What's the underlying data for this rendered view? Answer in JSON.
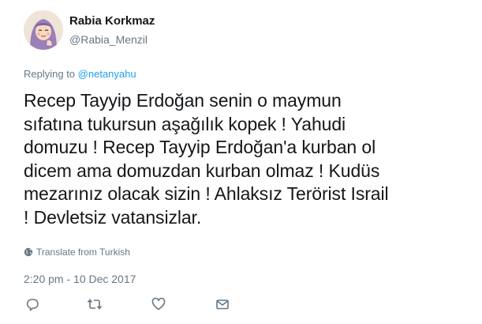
{
  "user": {
    "name": "Rabia Korkmaz",
    "handle": "@Rabia_Menzil"
  },
  "reply": {
    "prefix": "Replying to",
    "mention": "@netanyahu"
  },
  "tweet": {
    "lines": [
      "Recep Tayyip Erdoğan senin o maymun",
      "sıfatına tukursun aşağılık kopek ! Yahudi",
      "domuzu ! Recep Tayyip Erdoğan'a kurban ol",
      "dicem ama domuzdan kurban olmaz ! Kudüs",
      "mezarınız olacak sizin ! Ahlaksız Terörist Israil",
      "! Devletsiz vatansizlar."
    ]
  },
  "translate_label": "Translate from Turkish",
  "timestamp": "2:20 pm - 10 Dec 2017",
  "icons": {
    "avatar": "avatar-hijab-girl",
    "translate": "globe-icon",
    "reply": "reply-icon",
    "retweet": "retweet-icon",
    "like": "heart-icon",
    "message": "envelope-icon"
  },
  "colors": {
    "link": "#1da1f2",
    "secondary": "#657786",
    "text": "#14171a"
  }
}
